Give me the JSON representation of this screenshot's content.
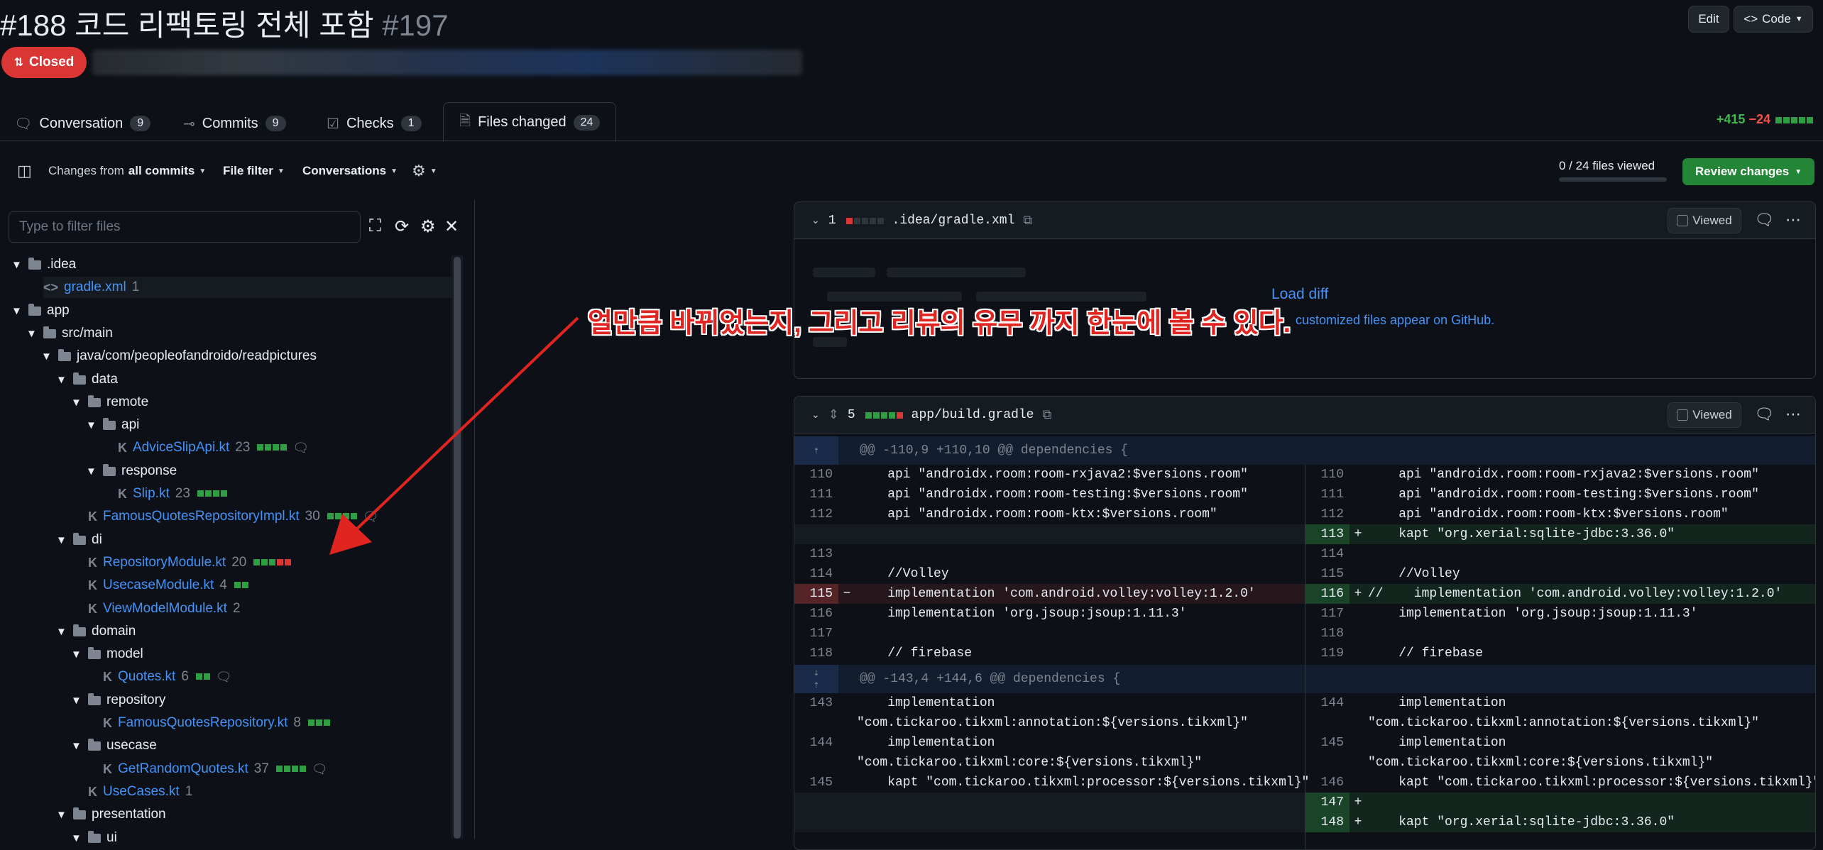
{
  "pr": {
    "title": "#188 코드 리팩토링 전체 포함",
    "number": "#197",
    "status": "Closed",
    "edit_label": "Edit",
    "code_label": "Code"
  },
  "tabs": [
    {
      "label": "Conversation",
      "count": "9",
      "icon": "conversation-icon"
    },
    {
      "label": "Commits",
      "count": "9",
      "icon": "commit-icon"
    },
    {
      "label": "Checks",
      "count": "1",
      "icon": "checklist-icon"
    },
    {
      "label": "Files changed",
      "count": "24",
      "icon": "file-diff-icon"
    }
  ],
  "diffstat": {
    "additions": "+415",
    "deletions": "−24"
  },
  "toolbar": {
    "changes_prefix": "Changes from",
    "changes_value": "all commits",
    "file_filter": "File filter",
    "conversations": "Conversations",
    "files_viewed": "0 / 24 files viewed",
    "files_viewed_fraction": 0,
    "review_changes": "Review changes"
  },
  "sidebar": {
    "filter_placeholder": "Type to filter files",
    "tree": [
      {
        "name": ".idea",
        "kind": "folder",
        "depth": 0
      },
      {
        "name": "gradle.xml",
        "kind": "xml",
        "depth": 1,
        "count": "1",
        "selected": true
      },
      {
        "name": "app",
        "kind": "folder",
        "depth": 0
      },
      {
        "name": "src/main",
        "kind": "folder",
        "depth": 1
      },
      {
        "name": "java/com/peopleofandroido/readpictures",
        "kind": "folder",
        "depth": 2
      },
      {
        "name": "data",
        "kind": "folder",
        "depth": 3
      },
      {
        "name": "remote",
        "kind": "folder",
        "depth": 4
      },
      {
        "name": "api",
        "kind": "folder",
        "depth": 5
      },
      {
        "name": "AdviceSlipApi.kt",
        "kind": "kt",
        "depth": 6,
        "count": "23",
        "bars": "gggg",
        "comment": true
      },
      {
        "name": "response",
        "kind": "folder",
        "depth": 5
      },
      {
        "name": "Slip.kt",
        "kind": "kt",
        "depth": 6,
        "count": "23",
        "bars": "gggg"
      },
      {
        "name": "FamousQuotesRepositoryImpl.kt",
        "kind": "kt",
        "depth": 4,
        "count": "30",
        "bars": "gggg",
        "comment": true
      },
      {
        "name": "di",
        "kind": "folder",
        "depth": 3
      },
      {
        "name": "RepositoryModule.kt",
        "kind": "kt",
        "depth": 4,
        "count": "20",
        "bars": "gggrr"
      },
      {
        "name": "UsecaseModule.kt",
        "kind": "kt",
        "depth": 4,
        "count": "4",
        "bars": "gg"
      },
      {
        "name": "ViewModelModule.kt",
        "kind": "kt",
        "depth": 4,
        "count": "2",
        "bars": ""
      },
      {
        "name": "domain",
        "kind": "folder",
        "depth": 3
      },
      {
        "name": "model",
        "kind": "folder",
        "depth": 4
      },
      {
        "name": "Quotes.kt",
        "kind": "kt",
        "depth": 5,
        "count": "6",
        "bars": "gg",
        "comment": true
      },
      {
        "name": "repository",
        "kind": "folder",
        "depth": 4
      },
      {
        "name": "FamousQuotesRepository.kt",
        "kind": "kt",
        "depth": 5,
        "count": "8",
        "bars": "ggg"
      },
      {
        "name": "usecase",
        "kind": "folder",
        "depth": 4
      },
      {
        "name": "GetRandomQuotes.kt",
        "kind": "kt",
        "depth": 5,
        "count": "37",
        "bars": "gggg",
        "comment": true
      },
      {
        "name": "UseCases.kt",
        "kind": "kt",
        "depth": 4,
        "count": "1",
        "bars": ""
      },
      {
        "name": "presentation",
        "kind": "folder",
        "depth": 3
      },
      {
        "name": "ui",
        "kind": "folder",
        "depth": 4
      }
    ]
  },
  "annotation": "얼만큼 바뀌었는지, 그리고 리뷰의 유무 까지 한눈에 볼 수 있다.",
  "files": [
    {
      "count": "1",
      "path": ".idea/gradle.xml",
      "viewed_label": "Viewed",
      "load_diff": "Load diff",
      "note": "customized files appear on GitHub."
    },
    {
      "count": "5",
      "path": "app/build.gradle",
      "viewed_label": "Viewed",
      "hunks": [
        {
          "header": "@@ -110,9 +110,10 @@ dependencies {",
          "rows": [
            {
              "l": "110",
              "lc": "    api \"androidx.room:room-rxjava2:$versions.room\"",
              "r": "110",
              "rc": "    api \"androidx.room:room-rxjava2:$versions.room\""
            },
            {
              "l": "111",
              "lc": "    api \"androidx.room:room-testing:$versions.room\"",
              "r": "111",
              "rc": "    api \"androidx.room:room-testing:$versions.room\""
            },
            {
              "l": "112",
              "lc": "    api \"androidx.room:room-ktx:$versions.room\"",
              "r": "112",
              "rc": "    api \"androidx.room:room-ktx:$versions.room\""
            },
            {
              "l": "",
              "lc": "",
              "r": "113",
              "rc": "    kapt \"org.xerial:sqlite-jdbc:3.36.0\"",
              "type": "add"
            },
            {
              "l": "113",
              "lc": "",
              "r": "114",
              "rc": ""
            },
            {
              "l": "114",
              "lc": "    //Volley",
              "r": "115",
              "rc": "    //Volley"
            },
            {
              "l": "115",
              "lc": "    implementation 'com.android.volley:volley:1.2.0'",
              "r": "116",
              "rc": "//    implementation 'com.android.volley:volley:1.2.0'",
              "type": "change"
            },
            {
              "l": "116",
              "lc": "    implementation 'org.jsoup:jsoup:1.11.3'",
              "r": "117",
              "rc": "    implementation 'org.jsoup:jsoup:1.11.3'"
            },
            {
              "l": "117",
              "lc": "",
              "r": "118",
              "rc": ""
            },
            {
              "l": "118",
              "lc": "    // firebase",
              "r": "119",
              "rc": "    // firebase"
            }
          ]
        },
        {
          "header": "@@ -143,4 +144,6 @@ dependencies {",
          "rows": [
            {
              "l": "143",
              "lc": "    implementation",
              "r": "144",
              "rc": "    implementation"
            },
            {
              "l": "",
              "lc": "\"com.tickaroo.tikxml:annotation:${versions.tikxml}\"",
              "r": "",
              "rc": "\"com.tickaroo.tikxml:annotation:${versions.tikxml}\""
            },
            {
              "l": "144",
              "lc": "    implementation",
              "r": "145",
              "rc": "    implementation"
            },
            {
              "l": "",
              "lc": "\"com.tickaroo.tikxml:core:${versions.tikxml}\"",
              "r": "",
              "rc": "\"com.tickaroo.tikxml:core:${versions.tikxml}\""
            },
            {
              "l": "145",
              "lc": "    kapt \"com.tickaroo.tikxml:processor:${versions.tikxml}\"",
              "r": "146",
              "rc": "    kapt \"com.tickaroo.tikxml:processor:${versions.tikxml}\""
            },
            {
              "l": "",
              "lc": "",
              "r": "147",
              "rc": "",
              "type": "add"
            },
            {
              "l": "",
              "lc": "",
              "r": "148",
              "rc": "    kapt \"org.xerial:sqlite-jdbc:3.36.0\"",
              "type": "add"
            }
          ]
        }
      ]
    }
  ]
}
